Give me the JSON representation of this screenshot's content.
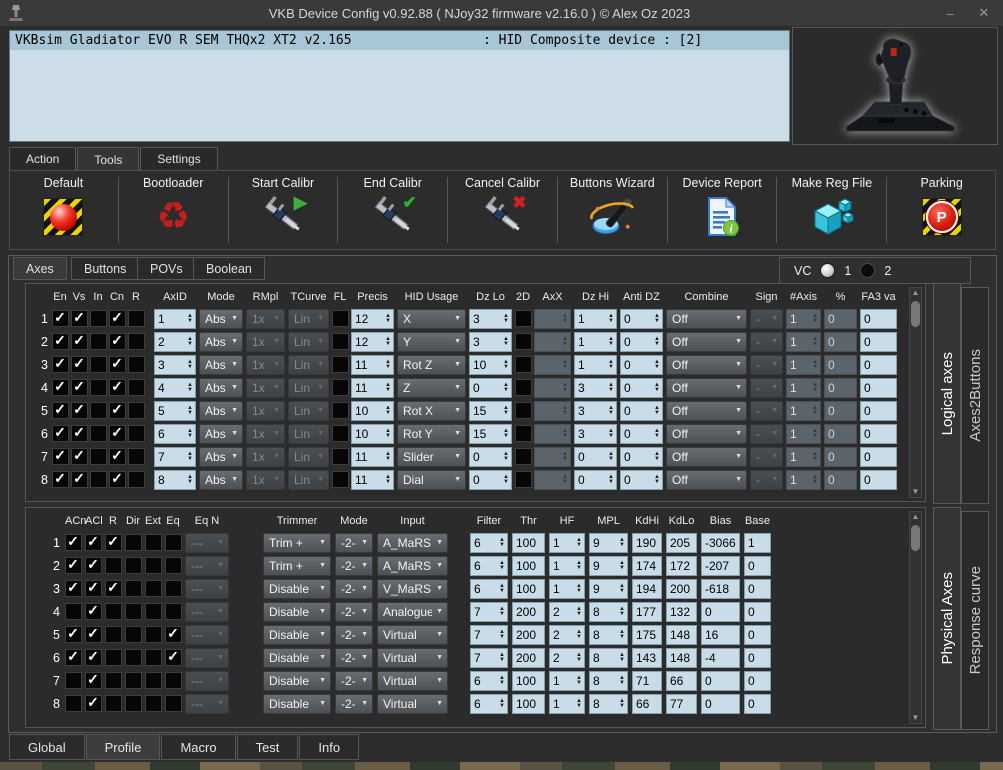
{
  "titlebar": {
    "title": "VKB Device Config v0.92.88 ( NJoy32 firmware v2.16.0 ) © Alex Oz 2023",
    "minimize": "–",
    "close": "✕"
  },
  "device_panel": {
    "selected_device": "VKBsim Gladiator EVO R SEM THQx2 XT2 v2.165",
    "device_status": ": HID Composite device : [2]"
  },
  "main_tabs": [
    {
      "label": "Action",
      "active": false
    },
    {
      "label": "Tools",
      "active": true
    },
    {
      "label": "Settings",
      "active": false
    }
  ],
  "toolbar": {
    "buttons": [
      {
        "label": "Default",
        "icon": "hazard-ball-icon"
      },
      {
        "label": "Bootloader",
        "icon": "recycle-icon"
      },
      {
        "label": "Start Calibr",
        "icon": "caliper-play-icon"
      },
      {
        "label": "End Calibr",
        "icon": "caliper-check-icon"
      },
      {
        "label": "Cancel Calibr",
        "icon": "caliper-cancel-icon"
      },
      {
        "label": "Buttons Wizard",
        "icon": "magic-wand-icon"
      },
      {
        "label": "Device Report",
        "icon": "report-document-icon"
      },
      {
        "label": "Make Reg File",
        "icon": "registry-cube-icon"
      },
      {
        "label": "Parking",
        "icon": "parking-icon"
      }
    ]
  },
  "axes_section": {
    "tabs": [
      {
        "label": "Axes",
        "active": true
      },
      {
        "label": "Buttons",
        "active": false
      },
      {
        "label": "POVs",
        "active": false
      },
      {
        "label": "Boolean",
        "active": false
      }
    ],
    "vc": {
      "label": "VC",
      "options": [
        {
          "label": "1",
          "selected": true
        },
        {
          "label": "2",
          "selected": false
        }
      ]
    },
    "logical": {
      "side_tabs": [
        {
          "label": "Logical axes",
          "active": true
        },
        {
          "label": "Axes2Buttons",
          "active": false
        }
      ],
      "headers": [
        "",
        "En",
        "Vs",
        "In",
        "Cn",
        "R",
        "",
        "AxID",
        "Mode",
        "RMpl",
        "TCurve",
        "FL",
        "Precis",
        "HID Usage",
        "Dz Lo",
        "2D",
        "AxX",
        "Dz Hi",
        "Anti DZ",
        "Combine",
        "Sign",
        "#Axis",
        "%",
        "FA3 va"
      ],
      "rows": [
        {
          "num": "1",
          "en": true,
          "vs": true,
          "in": false,
          "cn": true,
          "r": false,
          "axid": "1",
          "mode": "Abs",
          "rmpl": "1x",
          "tcurve": "Lin",
          "fl": false,
          "precis": "12",
          "hid": "X",
          "dz_lo": "3",
          "d2": false,
          "axx": "",
          "dz_hi": "1",
          "anti_dz": "0",
          "combine": "Off",
          "sign": "-",
          "naxis": "1",
          "pct": "0",
          "fa3": "0"
        },
        {
          "num": "2",
          "en": true,
          "vs": true,
          "in": false,
          "cn": true,
          "r": false,
          "axid": "2",
          "mode": "Abs",
          "rmpl": "1x",
          "tcurve": "Lin",
          "fl": false,
          "precis": "12",
          "hid": "Y",
          "dz_lo": "3",
          "d2": false,
          "axx": "",
          "dz_hi": "1",
          "anti_dz": "0",
          "combine": "Off",
          "sign": "-",
          "naxis": "1",
          "pct": "0",
          "fa3": "0"
        },
        {
          "num": "3",
          "en": true,
          "vs": true,
          "in": false,
          "cn": true,
          "r": false,
          "axid": "3",
          "mode": "Abs",
          "rmpl": "1x",
          "tcurve": "Lin",
          "fl": false,
          "precis": "11",
          "hid": "Rot Z",
          "dz_lo": "10",
          "d2": false,
          "axx": "",
          "dz_hi": "1",
          "anti_dz": "0",
          "combine": "Off",
          "sign": "-",
          "naxis": "1",
          "pct": "0",
          "fa3": "0"
        },
        {
          "num": "4",
          "en": true,
          "vs": true,
          "in": false,
          "cn": true,
          "r": false,
          "axid": "4",
          "mode": "Abs",
          "rmpl": "1x",
          "tcurve": "Lin",
          "fl": false,
          "precis": "11",
          "hid": "Z",
          "dz_lo": "0",
          "d2": false,
          "axx": "",
          "dz_hi": "3",
          "anti_dz": "0",
          "combine": "Off",
          "sign": "-",
          "naxis": "1",
          "pct": "0",
          "fa3": "0"
        },
        {
          "num": "5",
          "en": true,
          "vs": true,
          "in": false,
          "cn": true,
          "r": false,
          "axid": "5",
          "mode": "Abs",
          "rmpl": "1x",
          "tcurve": "Lin",
          "fl": false,
          "precis": "10",
          "hid": "Rot X",
          "dz_lo": "15",
          "d2": false,
          "axx": "",
          "dz_hi": "3",
          "anti_dz": "0",
          "combine": "Off",
          "sign": "-",
          "naxis": "1",
          "pct": "0",
          "fa3": "0"
        },
        {
          "num": "6",
          "en": true,
          "vs": true,
          "in": false,
          "cn": true,
          "r": false,
          "axid": "6",
          "mode": "Abs",
          "rmpl": "1x",
          "tcurve": "Lin",
          "fl": false,
          "precis": "10",
          "hid": "Rot Y",
          "dz_lo": "15",
          "d2": false,
          "axx": "",
          "dz_hi": "3",
          "anti_dz": "0",
          "combine": "Off",
          "sign": "-",
          "naxis": "1",
          "pct": "0",
          "fa3": "0"
        },
        {
          "num": "7",
          "en": true,
          "vs": true,
          "in": false,
          "cn": true,
          "r": false,
          "axid": "7",
          "mode": "Abs",
          "rmpl": "1x",
          "tcurve": "Lin",
          "fl": false,
          "precis": "11",
          "hid": "Slider",
          "dz_lo": "0",
          "d2": false,
          "axx": "",
          "dz_hi": "0",
          "anti_dz": "0",
          "combine": "Off",
          "sign": "-",
          "naxis": "1",
          "pct": "0",
          "fa3": "0"
        },
        {
          "num": "8",
          "en": true,
          "vs": true,
          "in": false,
          "cn": true,
          "r": false,
          "axid": "8",
          "mode": "Abs",
          "rmpl": "1x",
          "tcurve": "Lin",
          "fl": false,
          "precis": "11",
          "hid": "Dial",
          "dz_lo": "0",
          "d2": false,
          "axx": "",
          "dz_hi": "0",
          "anti_dz": "0",
          "combine": "Off",
          "sign": "-",
          "naxis": "1",
          "pct": "0",
          "fa3": "0"
        }
      ]
    },
    "physical": {
      "side_tabs": [
        {
          "label": "Physical Axes",
          "active": true
        },
        {
          "label": "Response curve",
          "active": false
        }
      ],
      "headers": [
        "",
        "ACn",
        "ACl",
        "R",
        "Dir",
        "Ext",
        "Eq",
        "Eq N",
        "",
        "Trimmer",
        "Mode",
        "Input",
        "",
        "Filter",
        "Thr",
        "HF",
        "MPL",
        "KdHi",
        "KdLo",
        "Bias",
        "Base"
      ],
      "rows": [
        {
          "num": "1",
          "acn": true,
          "acl": true,
          "r": true,
          "dir": false,
          "ext": false,
          "eq": false,
          "eq_n": "---",
          "trimmer": "Trim +",
          "mode": "-2-",
          "input": "A_MaRS",
          "filter": "6",
          "thr": "100",
          "hf": "1",
          "mpl": "9",
          "kdhi": "190",
          "kdlo": "205",
          "bias": "-3066",
          "base": "1"
        },
        {
          "num": "2",
          "acn": true,
          "acl": true,
          "r": false,
          "dir": false,
          "ext": false,
          "eq": false,
          "eq_n": "---",
          "trimmer": "Trim +",
          "mode": "-2-",
          "input": "A_MaRS",
          "filter": "6",
          "thr": "100",
          "hf": "1",
          "mpl": "9",
          "kdhi": "174",
          "kdlo": "172",
          "bias": "-207",
          "base": "0"
        },
        {
          "num": "3",
          "acn": true,
          "acl": true,
          "r": true,
          "dir": false,
          "ext": false,
          "eq": false,
          "eq_n": "---",
          "trimmer": "Disable",
          "mode": "-2-",
          "input": "V_MaRS",
          "filter": "6",
          "thr": "100",
          "hf": "1",
          "mpl": "9",
          "kdhi": "194",
          "kdlo": "200",
          "bias": "-618",
          "base": "0"
        },
        {
          "num": "4",
          "acn": false,
          "acl": true,
          "r": false,
          "dir": false,
          "ext": false,
          "eq": false,
          "eq_n": "---",
          "trimmer": "Disable",
          "mode": "-2-",
          "input": "Analogue",
          "filter": "7",
          "thr": "200",
          "hf": "2",
          "mpl": "8",
          "kdhi": "177",
          "kdlo": "132",
          "bias": "0",
          "base": "0"
        },
        {
          "num": "5",
          "acn": true,
          "acl": true,
          "r": false,
          "dir": false,
          "ext": false,
          "eq": true,
          "eq_n": "---",
          "trimmer": "Disable",
          "mode": "-2-",
          "input": "Virtual",
          "filter": "7",
          "thr": "200",
          "hf": "2",
          "mpl": "8",
          "kdhi": "175",
          "kdlo": "148",
          "bias": "16",
          "base": "0"
        },
        {
          "num": "6",
          "acn": true,
          "acl": true,
          "r": false,
          "dir": false,
          "ext": false,
          "eq": true,
          "eq_n": "---",
          "trimmer": "Disable",
          "mode": "-2-",
          "input": "Virtual",
          "filter": "7",
          "thr": "200",
          "hf": "2",
          "mpl": "8",
          "kdhi": "143",
          "kdlo": "148",
          "bias": "-4",
          "base": "0"
        },
        {
          "num": "7",
          "acn": false,
          "acl": true,
          "r": false,
          "dir": false,
          "ext": false,
          "eq": false,
          "eq_n": "---",
          "trimmer": "Disable",
          "mode": "-2-",
          "input": "Virtual",
          "filter": "6",
          "thr": "100",
          "hf": "1",
          "mpl": "8",
          "kdhi": "71",
          "kdlo": "66",
          "bias": "0",
          "base": "0"
        },
        {
          "num": "8",
          "acn": false,
          "acl": true,
          "r": false,
          "dir": false,
          "ext": false,
          "eq": false,
          "eq_n": "---",
          "trimmer": "Disable",
          "mode": "-2-",
          "input": "Virtual",
          "filter": "6",
          "thr": "100",
          "hf": "1",
          "mpl": "8",
          "kdhi": "66",
          "kdlo": "77",
          "bias": "0",
          "base": "0"
        }
      ]
    }
  },
  "bottom_tabs": [
    {
      "label": "Global",
      "active": false
    },
    {
      "label": "Profile",
      "active": true
    },
    {
      "label": "Macro",
      "active": false
    },
    {
      "label": "Test",
      "active": false
    },
    {
      "label": "Info",
      "active": false
    }
  ],
  "colors": {
    "field_blue": "#c9dde9",
    "selected_row_blue": "#a9c6d6",
    "window_bg": "#2d2d2d",
    "accent_red": "#c41f1f"
  }
}
